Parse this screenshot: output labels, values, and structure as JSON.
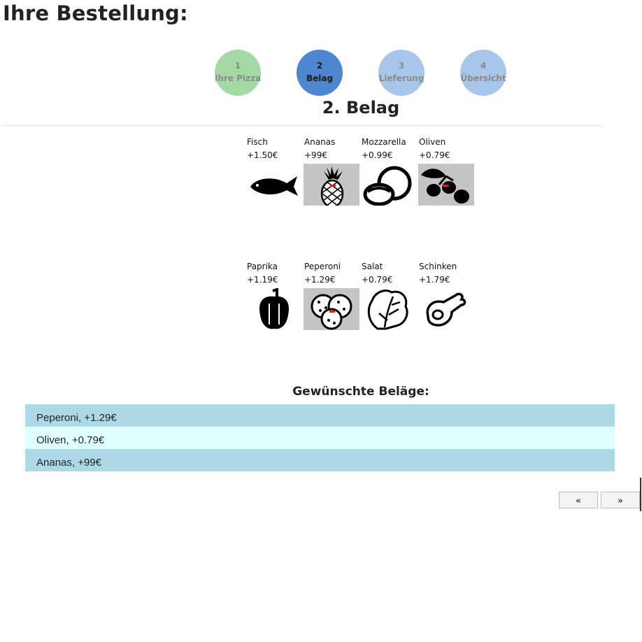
{
  "page": {
    "title": "Ihre Bestellung:"
  },
  "steps": [
    {
      "num": "1",
      "label": "Ihre Pizza"
    },
    {
      "num": "2",
      "label": "Belag"
    },
    {
      "num": "3",
      "label": "Lieferung"
    },
    {
      "num": "4",
      "label": "Übersicht"
    }
  ],
  "section": {
    "title": "2. Belag"
  },
  "toppings": [
    {
      "name": "Fisch",
      "price": "+1.50€",
      "icon": "fish-icon"
    },
    {
      "name": "Ananas",
      "price": "+99€",
      "icon": "pineapple-icon"
    },
    {
      "name": "Mozzarella",
      "price": "+0.99€",
      "icon": "mozzarella-icon"
    },
    {
      "name": "Oliven",
      "price": "+0.79€",
      "icon": "olives-icon"
    },
    {
      "name": "Paprika",
      "price": "+1.19€",
      "icon": "pepper-icon"
    },
    {
      "name": "Peperoni",
      "price": "+1.29€",
      "icon": "pepperoni-icon"
    },
    {
      "name": "Salat",
      "price": "+0.79€",
      "icon": "lettuce-icon"
    },
    {
      "name": "Schinken",
      "price": "+1.79€",
      "icon": "ham-icon"
    }
  ],
  "selection": {
    "title": "Gewünschte Beläge:",
    "items": [
      "Peperoni, +1.29€",
      "Oliven, +0.79€",
      "Ananas, +99€"
    ]
  },
  "nav": {
    "prev_label": "«",
    "next_label": "»"
  },
  "colors": {
    "step_done": "#a4d8a4",
    "step_active": "#4e87d0",
    "step_todo": "#a8c5ea",
    "row_odd": "#add8e6",
    "row_even": "#e0ffff",
    "selected_tile": "#c4c4c4"
  }
}
